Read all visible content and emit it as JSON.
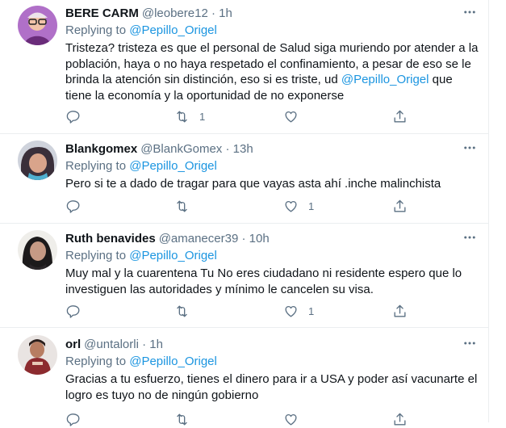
{
  "tweets": [
    {
      "name": "BERE CARM",
      "handle": "@leobere12",
      "sep": "·",
      "time": "1h",
      "reply_prefix": "Replying to",
      "reply_to": "@Pepillo_Origel",
      "text_before": "Tristeza? tristeza es que el personal de Salud siga muriendo por atender a la población, haya o no haya respetado el confinamiento, a pesar de eso se le brinda la atención sin distinción, eso si es triste, ud ",
      "text_mention": "@Pepillo_Origel",
      "text_after": " que tiene la economía y la oportunidad de no exponerse",
      "reply_count": "",
      "retweet_count": "1",
      "like_count": ""
    },
    {
      "name": "Blankgomex",
      "handle": "@BlankGomex",
      "sep": "·",
      "time": "13h",
      "reply_prefix": "Replying to",
      "reply_to": "@Pepillo_Origel",
      "text": "Pero si te a dado de tragar para que vayas asta ahí .inche malinchista",
      "reply_count": "",
      "retweet_count": "",
      "like_count": "1"
    },
    {
      "name": "Ruth benavides",
      "handle": "@amanecer39",
      "sep": "·",
      "time": "10h",
      "reply_prefix": "Replying to",
      "reply_to": "@Pepillo_Origel",
      "text": "Muy mal y la cuarentena Tu No eres ciudadano ni residente espero que lo investiguen las autoridades y mínimo le cancelen su visa.",
      "reply_count": "",
      "retweet_count": "",
      "like_count": "1"
    },
    {
      "name": "orl",
      "handle": "@untalorli",
      "sep": "·",
      "time": "1h",
      "reply_prefix": "Replying to",
      "reply_to": "@Pepillo_Origel",
      "text": "Gracias a tu esfuerzo, tienes el dinero para ir a USA y poder así vacunarte el logro es tuyo no de ningún gobierno",
      "reply_count": "",
      "retweet_count": "",
      "like_count": ""
    }
  ],
  "icons": {
    "more": "more-horizontal-icon",
    "reply": "reply-bubble-icon",
    "retweet": "retweet-arrows-icon",
    "like": "heart-outline-icon",
    "share": "share-upload-icon"
  },
  "colors": {
    "text": "#0f1419",
    "secondary": "#5b7083",
    "link": "#1b95e0",
    "divider": "#ebeef0"
  }
}
